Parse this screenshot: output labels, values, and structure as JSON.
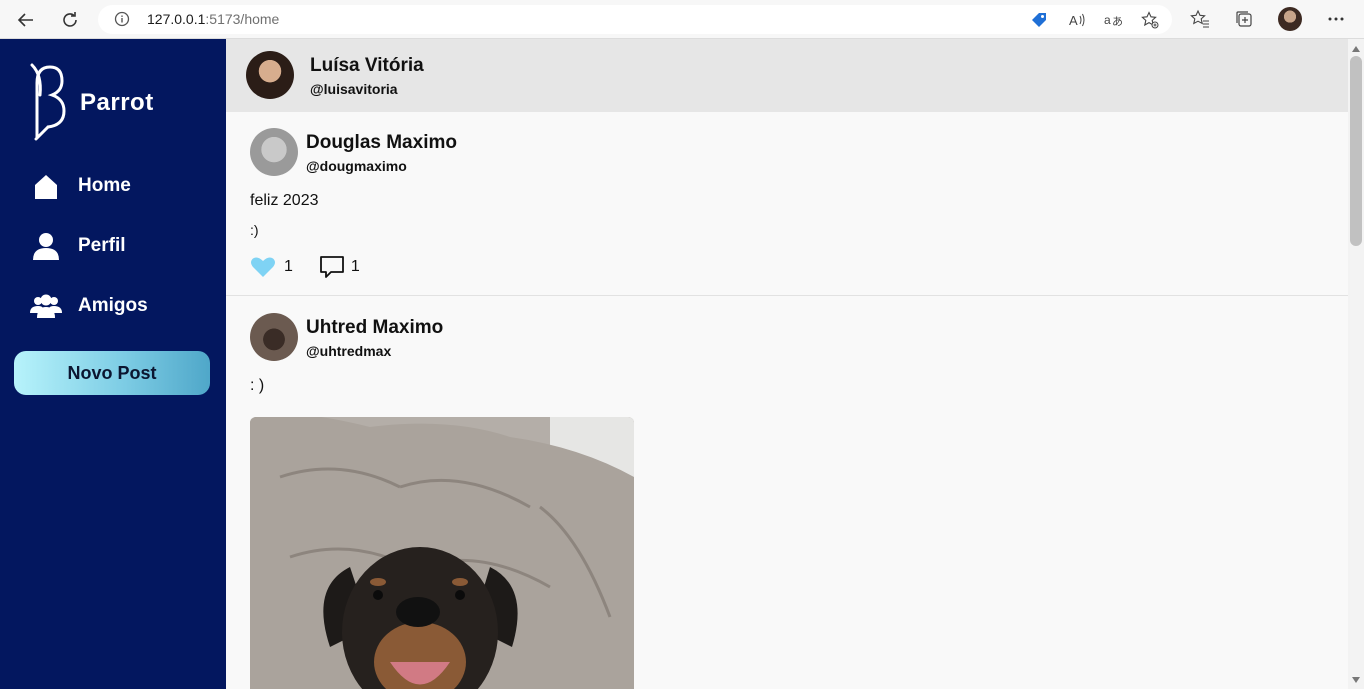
{
  "browser": {
    "url_host": "127.0.0.1",
    "url_path": ":5173/home"
  },
  "sidebar": {
    "brand": "Parrot",
    "items": [
      {
        "label": "Home",
        "icon": "home-icon"
      },
      {
        "label": "Perfil",
        "icon": "user-icon"
      },
      {
        "label": "Amigos",
        "icon": "users-icon"
      }
    ],
    "new_post_label": "Novo Post"
  },
  "header": {
    "name": "Luísa Vitória",
    "handle": "@luisavitoria"
  },
  "posts": [
    {
      "name": "Douglas Maximo",
      "handle": "@dougmaximo",
      "text_lines": [
        "feliz 2023",
        ":)"
      ],
      "likes": "1",
      "comments": "1"
    },
    {
      "name": "Uhtred Maximo",
      "handle": "@uhtredmax",
      "text_lines": [
        ": )"
      ]
    }
  ],
  "colors": {
    "sidebar_bg": "#03175f",
    "header_bg": "#e6e6e6",
    "like_color": "#7fd3f4",
    "button_gradient_start": "#b7f3fb",
    "button_gradient_end": "#4fa7c9"
  }
}
